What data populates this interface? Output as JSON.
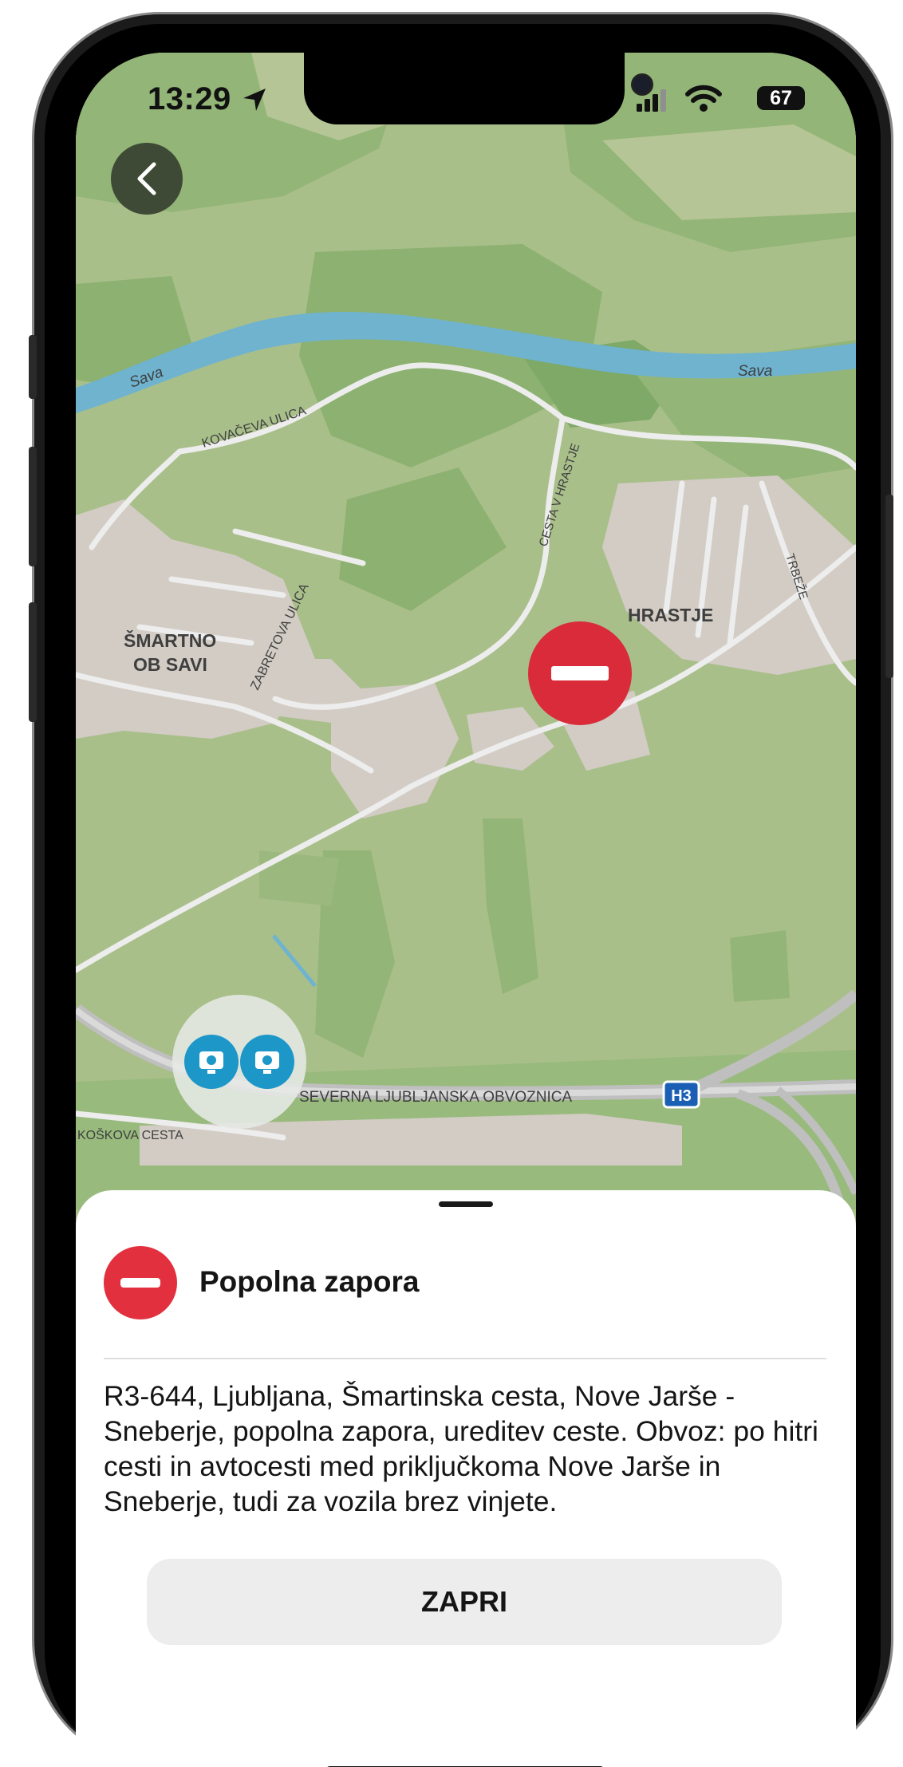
{
  "status_bar": {
    "time": "13:29",
    "battery": "67"
  },
  "map": {
    "labels": {
      "river_left": "Sava",
      "river_right": "Sava",
      "kovaceva": "KOVAČEVA ULICA",
      "cesta_v_hrastje": "CESTA V HRASTJE",
      "hrastje": "HRASTJE",
      "trbeze": "TRBEŽE",
      "smartno_line1": "ŠMARTNO",
      "smartno_line2": "OB SAVI",
      "zabretova": "ZABRETOVA ULICA",
      "obvoznica": "SEVERNA LJUBLJANSKA OBVOZNICA",
      "koskova": "KOŠKOVA CESTA",
      "highway_shield": "H3"
    },
    "markers": {
      "closure_icon": "no-entry-icon",
      "cameras_icon": "speed-camera-icon"
    }
  },
  "sheet": {
    "title": "Popolna zapora",
    "description": "R3-644, Ljubljana, Šmartinska cesta, Nove Jarše - Sneberje, popolna zapora, ureditev ceste. Obvoz: po hitri cesti in avtocesti med priključkoma Nove Jarše in Sneberje, tudi za vozila brez vinjete.",
    "close_label": "ZAPRI"
  },
  "colors": {
    "closure_red": "#e3303f",
    "camera_blue": "#1d97c8",
    "river": "#6fb3cf",
    "map_base": "#a9bf8a"
  }
}
